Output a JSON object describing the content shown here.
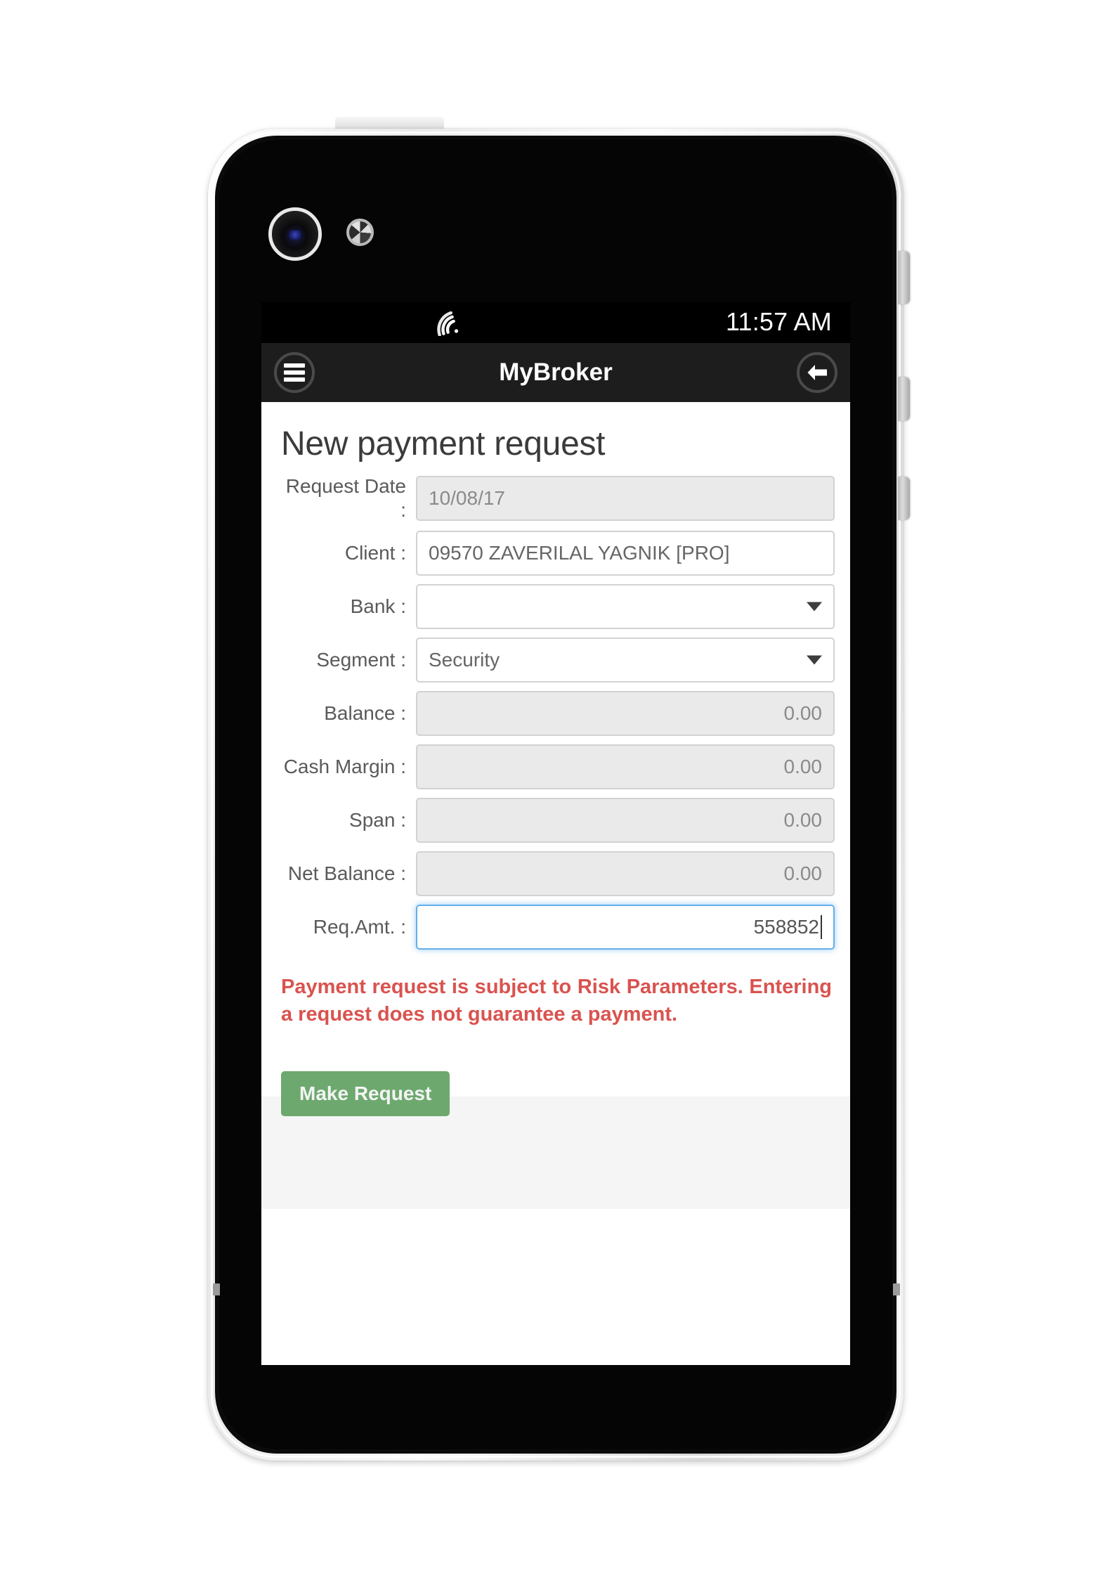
{
  "device": {
    "frame": "smartphone-white",
    "icons": {
      "camera": "camera-lens-icon",
      "sensor": "proximity-sensor-icon",
      "power_button": "power-button",
      "side_buttons": [
        "volume-up-button",
        "volume-down-button",
        "silent-switch"
      ]
    }
  },
  "status_bar": {
    "wifi_icon": "wifi-signal-icon",
    "time": "11:57 AM"
  },
  "app_bar": {
    "menu_icon": "hamburger-menu-icon",
    "title": "MyBroker",
    "back_icon": "back-arrow-icon"
  },
  "page": {
    "title": "New payment request",
    "fields": [
      {
        "label": "Request Date :",
        "value": "10/08/17",
        "type": "text",
        "state": "disabled",
        "align": "left"
      },
      {
        "label": "Client :",
        "value": "09570 ZAVERILAL YAGNIK [PRO]",
        "type": "text",
        "state": "enabled",
        "align": "left"
      },
      {
        "label": "Bank :",
        "value": "",
        "type": "select",
        "state": "enabled",
        "align": "left"
      },
      {
        "label": "Segment :",
        "value": "Security",
        "type": "select",
        "state": "enabled",
        "align": "left"
      },
      {
        "label": "Balance :",
        "value": "0.00",
        "type": "text",
        "state": "disabled",
        "align": "right"
      },
      {
        "label": "Cash Margin :",
        "value": "0.00",
        "type": "text",
        "state": "disabled",
        "align": "right"
      },
      {
        "label": "Span :",
        "value": "0.00",
        "type": "text",
        "state": "disabled",
        "align": "right"
      },
      {
        "label": "Net Balance :",
        "value": "0.00",
        "type": "text",
        "state": "disabled",
        "align": "right"
      },
      {
        "label": "Req.Amt. :",
        "value": "558852",
        "type": "text",
        "state": "focused",
        "align": "right"
      }
    ],
    "warning": "Payment request is subject to Risk Parameters. Entering a request does not guarantee a payment.",
    "submit_label": "Make Request"
  },
  "colors": {
    "app_bar_bg": "#1d1d1d",
    "status_bar_bg": "#000000",
    "warning_text": "#d9534f",
    "submit_button": "#6da96e",
    "focus_border": "#66afe9",
    "disabled_field_bg": "#eaeaea",
    "footer_bg": "#f5f5f5"
  }
}
